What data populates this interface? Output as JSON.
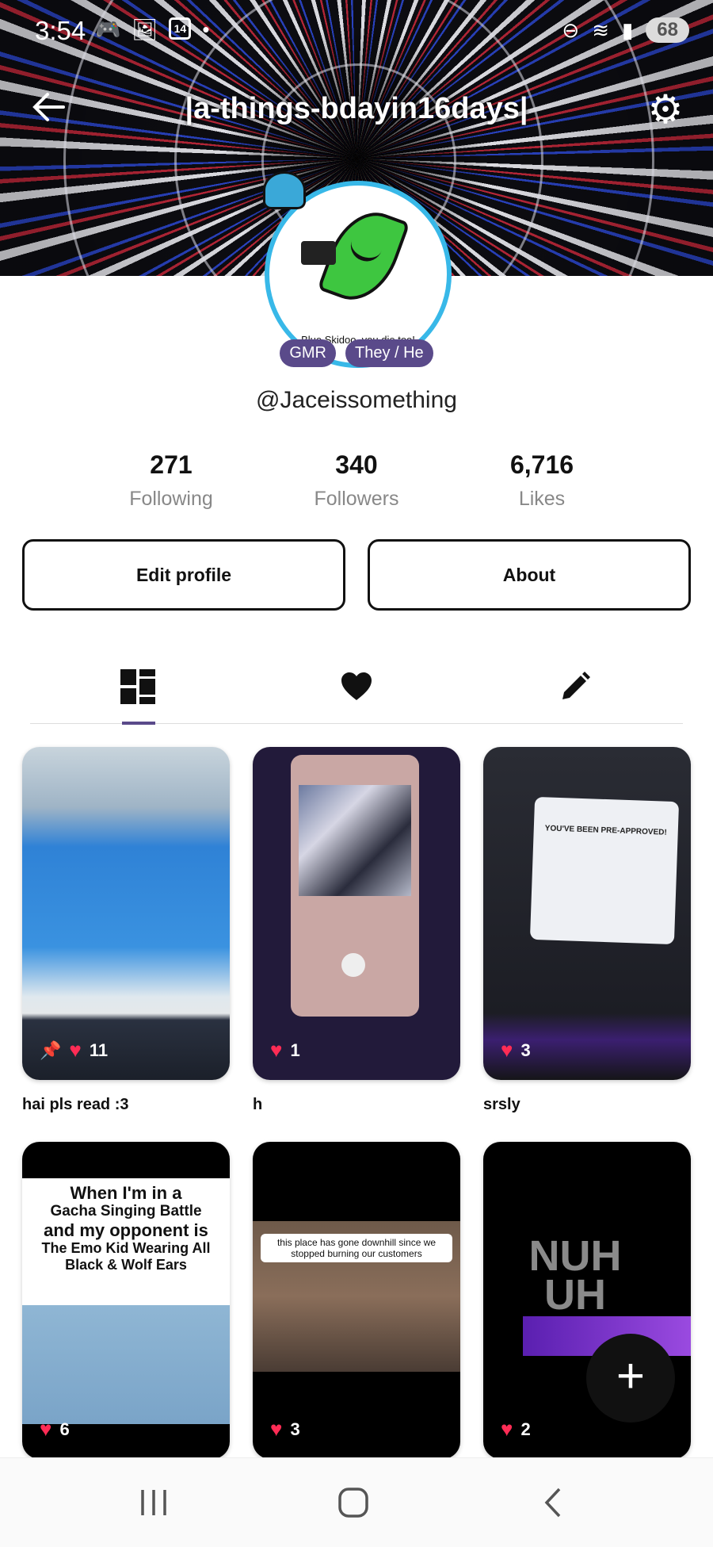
{
  "status_bar": {
    "time": "3:54",
    "calendar_day": "14",
    "battery": "68"
  },
  "header": {
    "title": "|a-things-bdayin16days|"
  },
  "avatar": {
    "caption": "Blue Skidoo, you die too!"
  },
  "badges": [
    "GMR",
    "They / He"
  ],
  "handle": "@Jaceissomething",
  "stats": [
    {
      "value": "271",
      "label": "Following"
    },
    {
      "value": "340",
      "label": "Followers"
    },
    {
      "value": "6,716",
      "label": "Likes"
    }
  ],
  "actions": {
    "edit_profile": "Edit profile",
    "about": "About"
  },
  "tabs": [
    {
      "icon": "grid-icon",
      "active": true
    },
    {
      "icon": "heart-icon",
      "active": false
    },
    {
      "icon": "pencil-icon",
      "active": false
    }
  ],
  "posts": [
    {
      "likes": "11",
      "pinned": true,
      "caption": "hai pls read :3"
    },
    {
      "likes": "1",
      "pinned": false,
      "caption": "h"
    },
    {
      "likes": "3",
      "pinned": false,
      "caption": "srsly",
      "ad_title": "YOU'VE BEEN PRE-APPROVED!"
    },
    {
      "likes": "6",
      "pinned": false,
      "caption": "",
      "meme_line1": "When I'm in a",
      "meme_line2": "Gacha Singing Battle",
      "meme_line3": "and my opponent is",
      "meme_line4": "The Emo Kid Wearing All Black & Wolf Ears"
    },
    {
      "likes": "3",
      "pinned": false,
      "caption": "",
      "speech": "this place has gone downhill since we stopped burning our customers"
    },
    {
      "likes": "2",
      "pinned": false,
      "caption": "",
      "big_text": "NUH UH"
    }
  ],
  "fab": "+",
  "colors": {
    "accent": "#5a4a8a",
    "heart": "#ff2c55"
  }
}
